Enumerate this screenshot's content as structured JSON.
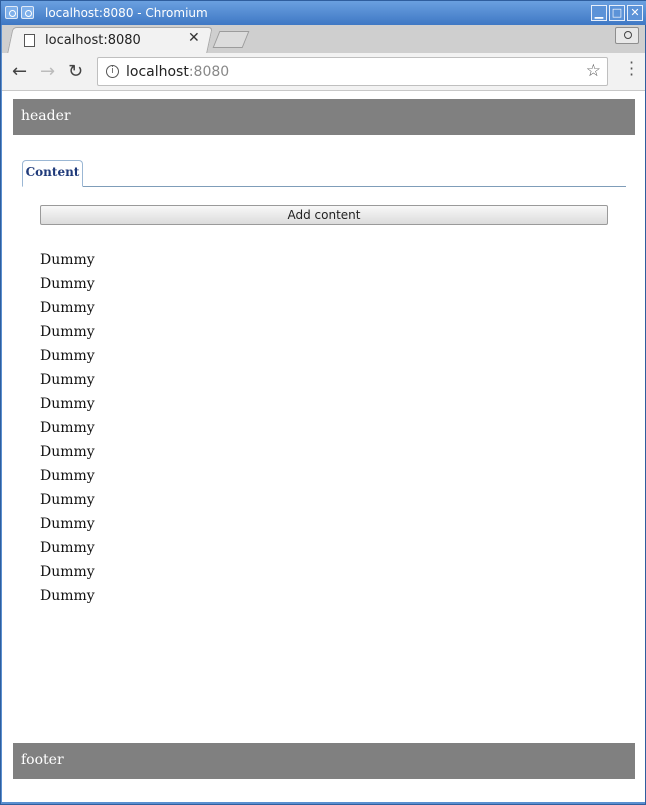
{
  "window": {
    "title": "localhost:8080 - Chromium",
    "controls": [
      "minimize",
      "maximize",
      "close"
    ]
  },
  "browser": {
    "tab_title": "localhost:8080",
    "address_host": "localhost",
    "address_port": ":8080"
  },
  "page": {
    "header": "header",
    "tabs": [
      {
        "label": "Content",
        "active": true
      }
    ],
    "add_button_label": "Add content",
    "items": [
      "Dummy",
      "Dummy",
      "Dummy",
      "Dummy",
      "Dummy",
      "Dummy",
      "Dummy",
      "Dummy",
      "Dummy",
      "Dummy",
      "Dummy",
      "Dummy",
      "Dummy",
      "Dummy",
      "Dummy"
    ],
    "footer": "footer"
  }
}
